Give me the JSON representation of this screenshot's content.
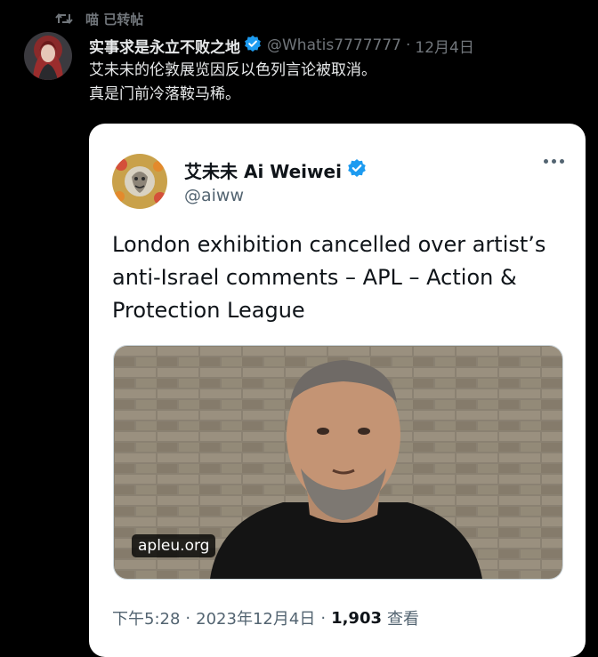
{
  "retweet": {
    "label": "喵 已转帖"
  },
  "tweet": {
    "author_name": "实事求是永立不败之地",
    "handle": "@Whatis7777777",
    "dot": "·",
    "date": "12月4日",
    "text_lines": [
      "艾未未的伦敦展览因反以色列言论被取消。",
      "真是门前冷落鞍马稀。"
    ]
  },
  "quote": {
    "author_name": "艾未未 Ai Weiwei",
    "handle": "@aiww",
    "text_lines": [
      "London exhibition cancelled over artist’s",
      "anti-Israel comments – APL – Action &",
      "Protection League"
    ],
    "media": {
      "domain": "apleu.org"
    },
    "footer": {
      "time": "下午5:28",
      "sep1": "·",
      "date": "2023年12月4日",
      "sep2": "·",
      "views_count": "1,903",
      "views_label": "查看"
    }
  },
  "icons": {
    "retweet": "retweet-icon",
    "verified": "verified-badge-icon",
    "more": "more-options-icon"
  },
  "colors": {
    "background": "#000000",
    "card_background": "#ffffff",
    "verified_blue": "#1d9bf0",
    "muted_text": "#71767b"
  }
}
